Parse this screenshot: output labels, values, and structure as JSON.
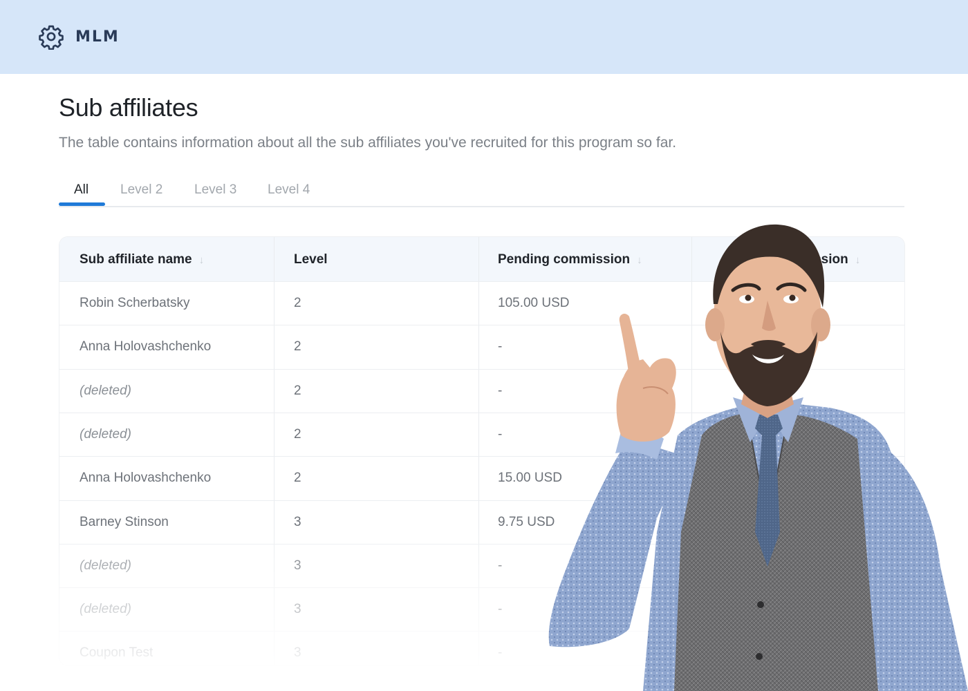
{
  "brand": {
    "name": "MLM",
    "icon": "gear-icon",
    "color": "#2a3b58"
  },
  "header_bg": "#d6e6f9",
  "page": {
    "title": "Sub affiliates",
    "description": "The table contains information about all the sub affiliates you've recruited for this program so far."
  },
  "tabs": [
    {
      "label": "All",
      "active": true
    },
    {
      "label": "Level 2",
      "active": false
    },
    {
      "label": "Level 3",
      "active": false
    },
    {
      "label": "Level 4",
      "active": false
    }
  ],
  "accent": "#1f7ad8",
  "table": {
    "columns": [
      {
        "label": "Sub affiliate name",
        "sortable": true,
        "sort_icon": "arrow-down-icon"
      },
      {
        "label": "Level",
        "sortable": false
      },
      {
        "label": "Pending commission",
        "sortable": true,
        "sort_icon": "arrow-down-icon"
      },
      {
        "label": "mmission",
        "sortable": true,
        "sort_icon": "arrow-down-icon"
      }
    ],
    "rows": [
      {
        "name": "Robin Scherbatsky",
        "level": "2",
        "pending": "105.00 USD",
        "deleted": false
      },
      {
        "name": "Anna Holovashchenko",
        "level": "2",
        "pending": "-",
        "deleted": false
      },
      {
        "name": "(deleted)",
        "level": "2",
        "pending": "-",
        "deleted": true
      },
      {
        "name": "(deleted)",
        "level": "2",
        "pending": "-",
        "deleted": true
      },
      {
        "name": "Anna Holovashchenko",
        "level": "2",
        "pending": "15.00 USD",
        "deleted": false
      },
      {
        "name": "Barney Stinson",
        "level": "3",
        "pending": "9.75 USD",
        "deleted": false
      },
      {
        "name": "(deleted)",
        "level": "3",
        "pending": "-",
        "deleted": true
      },
      {
        "name": "(deleted)",
        "level": "3",
        "pending": "-",
        "deleted": true
      },
      {
        "name": "Coupon Test",
        "level": "3",
        "pending": "-",
        "deleted": false
      }
    ]
  },
  "overlay": {
    "image": "man-pointing-up-photo"
  }
}
